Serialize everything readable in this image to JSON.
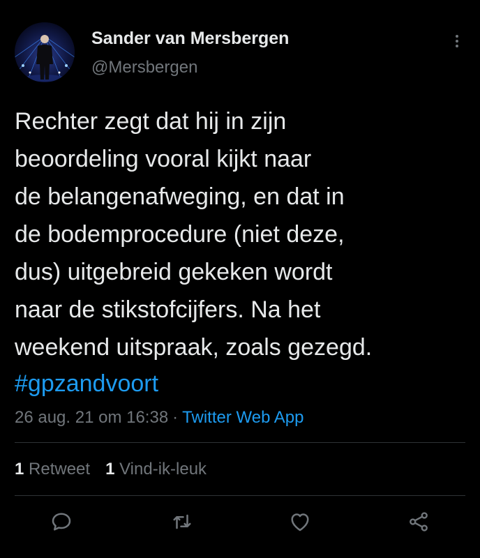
{
  "tweet": {
    "author_name": "Sander van Mersbergen",
    "author_handle": "@Mersbergen",
    "text": "Rechter zegt dat hij in zijn\nbeoordeling vooral kijkt naar\nde belangenafweging, en dat in\nde bodemprocedure (niet deze,\ndus) uitgebreid gekeken wordt\nnaar de stikstofcijfers. Na het\nweekend uitspraak, zoals gezegd.",
    "hashtag": "#gpzandvoort",
    "timestamp": "26 aug. 21 om 16:38",
    "separator": "·",
    "source": "Twitter Web App"
  },
  "stats": {
    "retweets_count": "1",
    "retweets_label": "Retweet",
    "likes_count": "1",
    "likes_label": "Vind-ik-leuk"
  },
  "actions": {
    "reply": "reply-icon",
    "retweet": "retweet-icon",
    "like": "heart-icon",
    "share": "share-icon"
  },
  "colors": {
    "background": "#000000",
    "text": "#e7e9ea",
    "secondary": "#71767b",
    "accent": "#1d9bf0",
    "divider": "#2f3336"
  }
}
